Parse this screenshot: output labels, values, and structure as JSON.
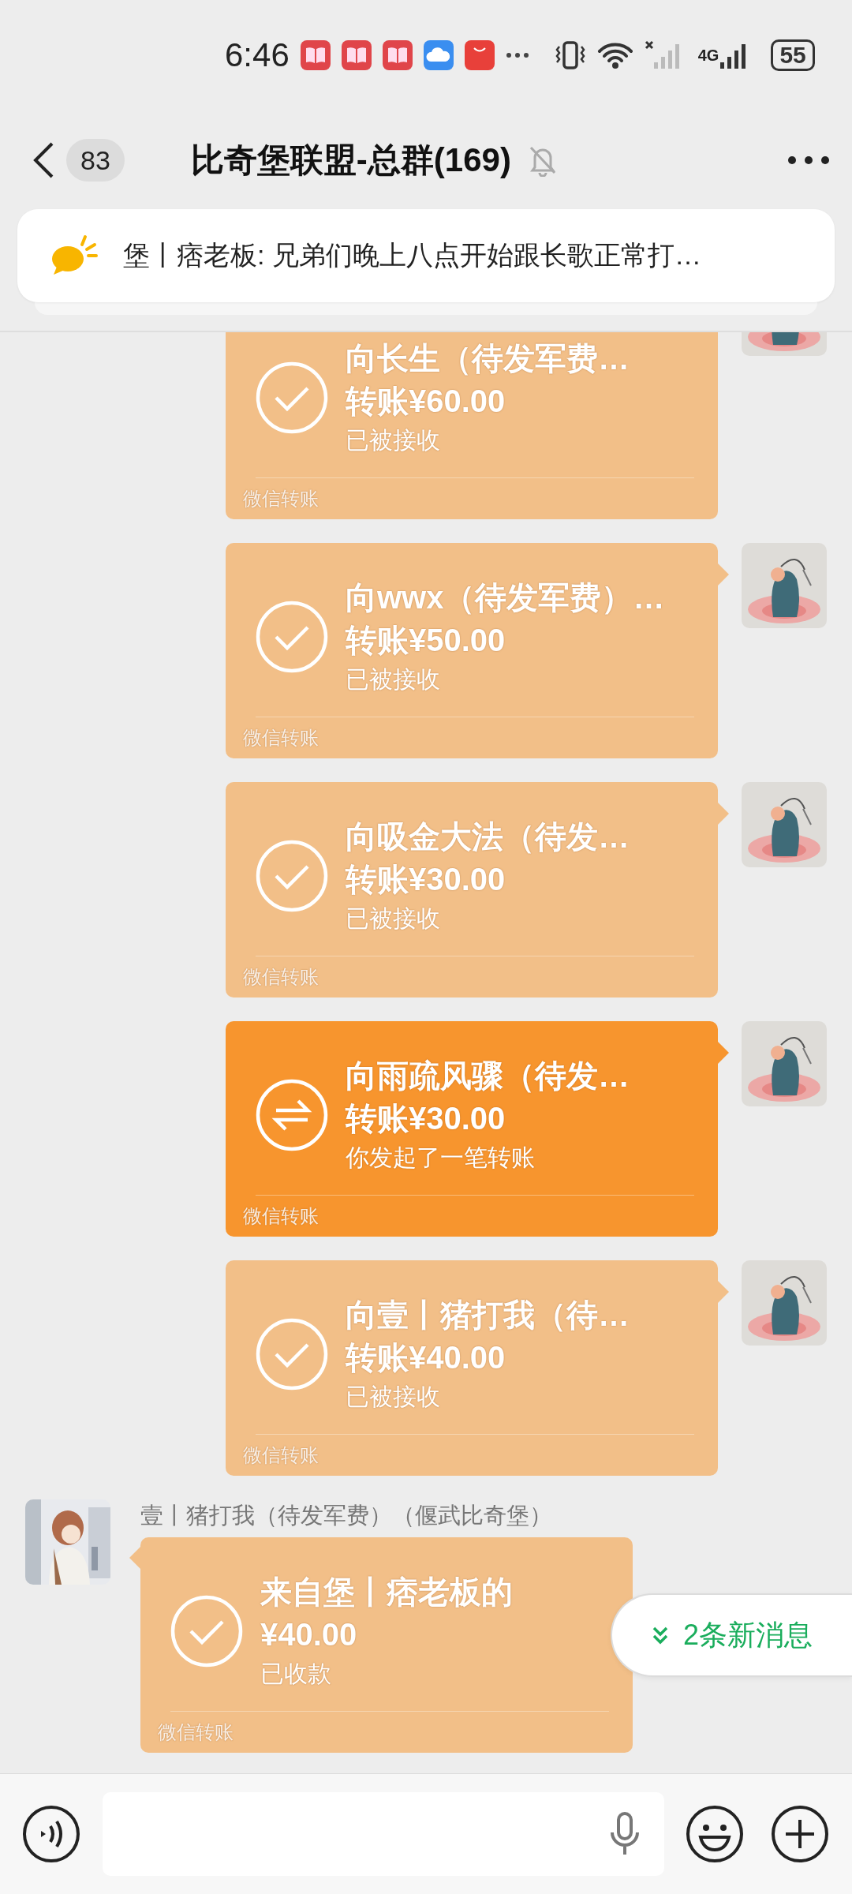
{
  "status_bar": {
    "time": "6:46",
    "network": "4G",
    "battery": "55"
  },
  "header": {
    "unread_count": "83",
    "title": "比奇堡联盟-总群(169)",
    "muted": true
  },
  "pinned_notice": {
    "text": "堡丨痞老板: 兄弟们晚上八点开始跟长歌正常打…"
  },
  "messages": [
    {
      "kind": "outgoing",
      "accepted": true,
      "title": "向长生（待发军费…",
      "amount": "转账¥60.00",
      "note": "已被接收",
      "footer": "微信转账"
    },
    {
      "kind": "outgoing",
      "accepted": true,
      "title": "向wwx（待发军费）…",
      "amount": "转账¥50.00",
      "note": "已被接收",
      "footer": "微信转账"
    },
    {
      "kind": "outgoing",
      "accepted": true,
      "title": "向吸金大法（待发…",
      "amount": "转账¥30.00",
      "note": "已被接收",
      "footer": "微信转账"
    },
    {
      "kind": "outgoing",
      "accepted": false,
      "title": "向雨疏风骤（待发…",
      "amount": "转账¥30.00",
      "note": "你发起了一笔转账",
      "footer": "微信转账"
    },
    {
      "kind": "outgoing",
      "accepted": true,
      "title": "向壹丨猪打我（待…",
      "amount": "转账¥40.00",
      "note": "已被接收",
      "footer": "微信转账"
    },
    {
      "kind": "incoming",
      "sender": "壹丨猪打我（待发军费）（偃武比奇堡）",
      "accepted": true,
      "title": "来自堡丨痞老板的",
      "amount": "¥40.00",
      "note": "已收款",
      "footer": "微信转账"
    }
  ],
  "new_messages_button": "2条新消息"
}
